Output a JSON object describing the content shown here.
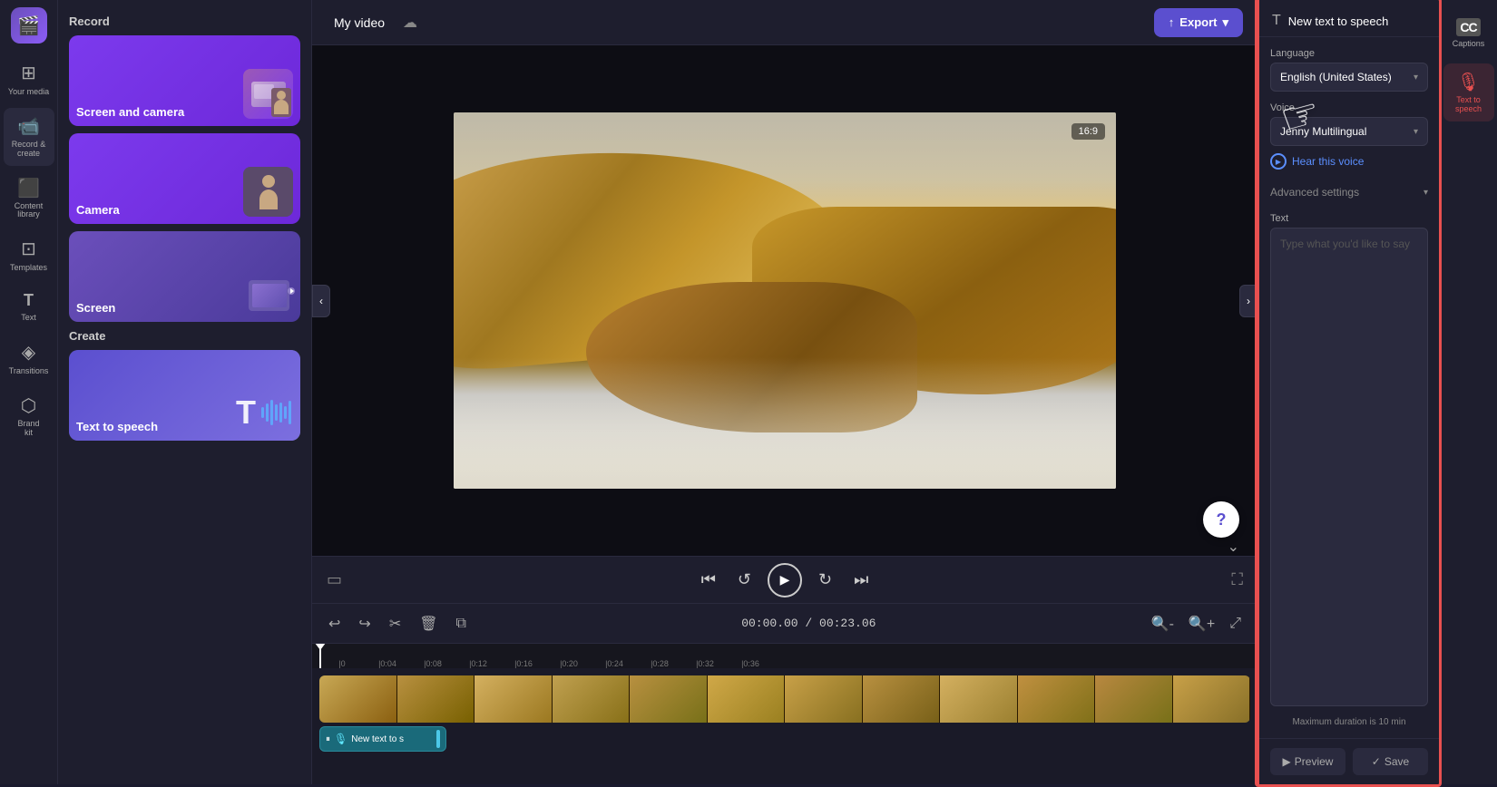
{
  "app": {
    "logo": "🎬"
  },
  "left_nav": {
    "items": [
      {
        "id": "your-media",
        "icon": "⊞",
        "label": "Your media"
      },
      {
        "id": "record-create",
        "icon": "📹",
        "label": "Record &\ncreate"
      },
      {
        "id": "content-library",
        "icon": "⬛",
        "label": "Content\nlibrary"
      },
      {
        "id": "templates",
        "icon": "⊡",
        "label": "Templates"
      },
      {
        "id": "text",
        "icon": "T",
        "label": "Text"
      },
      {
        "id": "transitions",
        "icon": "◈",
        "label": "Transitions"
      },
      {
        "id": "brand-kit",
        "icon": "⬡",
        "label": "Brand\nkit"
      }
    ]
  },
  "left_panel": {
    "record_section": "Record",
    "create_section": "Create",
    "record_items": [
      {
        "id": "screen-camera",
        "label": "Screen and camera"
      },
      {
        "id": "camera",
        "label": "Camera"
      },
      {
        "id": "screen",
        "label": "Screen"
      }
    ],
    "create_items": [
      {
        "id": "text-to-speech",
        "label": "Text to speech"
      }
    ]
  },
  "header": {
    "video_title": "My video",
    "export_label": "Export"
  },
  "video": {
    "aspect_ratio": "16:9"
  },
  "playback": {
    "current_time": "00:00.00",
    "total_time": "00:23.06"
  },
  "timeline": {
    "ruler_marks": [
      "0",
      "0:04",
      "0:08",
      "0:12",
      "0:16",
      "0:20",
      "0:24",
      "0:28",
      "0:32",
      "0:36"
    ],
    "tts_track_label": "New text to s"
  },
  "right_panel": {
    "title": "New text to speech",
    "language_label": "Language",
    "language_value": "English (United States)",
    "voice_label": "Voice",
    "voice_value": "Jenny Multilingual",
    "hear_voice_label": "Hear this voice",
    "advanced_settings_label": "Advanced settings",
    "text_label": "Text",
    "text_placeholder": "Type what you'd like to say",
    "max_duration_note": "Maximum duration is 10 min",
    "preview_label": "Preview",
    "save_label": "Save"
  },
  "far_right_nav": {
    "items": [
      {
        "id": "captions",
        "icon": "CC",
        "label": "Captions"
      },
      {
        "id": "text-to-speech-nav",
        "icon": "🎙",
        "label": "Text to\nspeech"
      }
    ]
  }
}
